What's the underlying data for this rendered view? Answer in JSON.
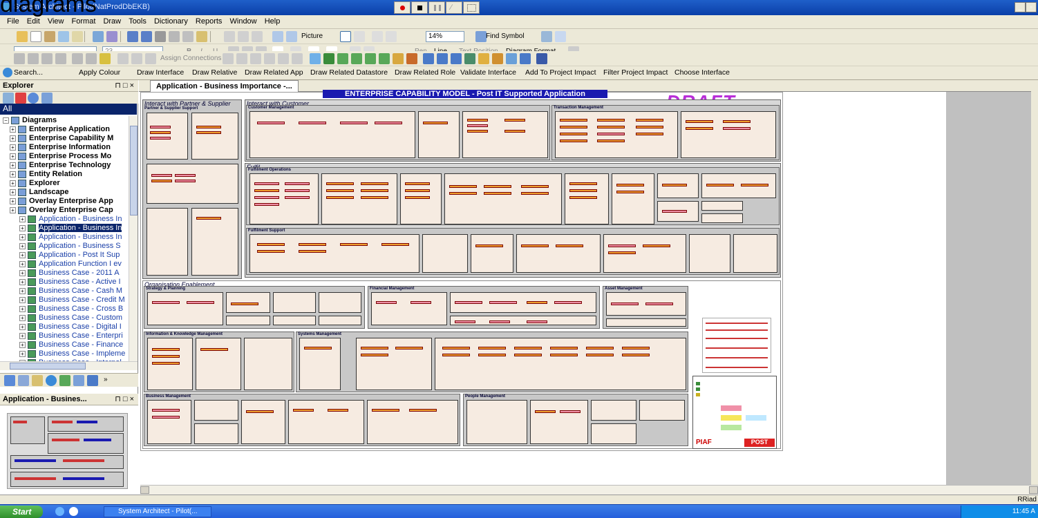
{
  "overlay_caption": "diagrams",
  "window": {
    "title": "System Architect - Pilot(NatProdDbEKB)"
  },
  "menu": [
    "File",
    "Edit",
    "View",
    "Format",
    "Draw",
    "Tools",
    "Dictionary",
    "Reports",
    "Window",
    "Help"
  ],
  "toolbar1": {
    "picture_label": "Picture",
    "zoom": "14%",
    "find_symbol": "Find Symbol"
  },
  "toolbar2": {
    "font_size": "23",
    "labels": [
      "Pen",
      "Line",
      "Text Position",
      "Diagram Format"
    ]
  },
  "toolbar3": {
    "assign_connections": "Assign Connections"
  },
  "commands": [
    "Search...",
    "Apply Colour",
    "Draw Interface",
    "Draw Relative",
    "Draw Related App",
    "Draw Related Datastore",
    "Draw Related Role",
    "Validate Interface",
    "Add To Project Impact",
    "Filter Project Impact",
    "Choose Interface"
  ],
  "explorer": {
    "title": "Explorer",
    "controls": "⊓ □ ×",
    "filter": "All",
    "tree": [
      {
        "label": "Diagrams",
        "level": 0,
        "bold": true
      },
      {
        "label": "Enterprise Application",
        "level": 1,
        "bold": true
      },
      {
        "label": "Enterprise Capability M",
        "level": 1,
        "bold": true
      },
      {
        "label": "Enterprise Information",
        "level": 1,
        "bold": true
      },
      {
        "label": "Enterprise Process Mo",
        "level": 1,
        "bold": true
      },
      {
        "label": "Enterprise Technology",
        "level": 1,
        "bold": true
      },
      {
        "label": "Entity Relation",
        "level": 1,
        "bold": true
      },
      {
        "label": "Explorer",
        "level": 1,
        "bold": true
      },
      {
        "label": "Landscape",
        "level": 1,
        "bold": true
      },
      {
        "label": "Overlay Enterprise App",
        "level": 1,
        "bold": true
      },
      {
        "label": "Overlay Enterprise Cap",
        "level": 1,
        "bold": true
      },
      {
        "label": "Application - Business In",
        "level": 2,
        "bold": false
      },
      {
        "label": "Application - Business In",
        "level": 2,
        "bold": false,
        "selected": true
      },
      {
        "label": "Application - Business In",
        "level": 2,
        "bold": false
      },
      {
        "label": "Application - Business S",
        "level": 2,
        "bold": false
      },
      {
        "label": "Application - Post It Sup",
        "level": 2,
        "bold": false
      },
      {
        "label": "Application Function I ev",
        "level": 2,
        "bold": false
      },
      {
        "label": "Business Case - 2011 A",
        "level": 2,
        "bold": false
      },
      {
        "label": "Business Case - Active I",
        "level": 2,
        "bold": false
      },
      {
        "label": "Business Case - Cash M",
        "level": 2,
        "bold": false
      },
      {
        "label": "Business Case - Credit M",
        "level": 2,
        "bold": false
      },
      {
        "label": "Business Case - Cross B",
        "level": 2,
        "bold": false
      },
      {
        "label": "Business Case - Custom",
        "level": 2,
        "bold": false
      },
      {
        "label": "Business Case - Digital I",
        "level": 2,
        "bold": false
      },
      {
        "label": "Business Case - Enterpri",
        "level": 2,
        "bold": false
      },
      {
        "label": "Business Case - Finance",
        "level": 2,
        "bold": false
      },
      {
        "label": "Business Case - Impleme",
        "level": 2,
        "bold": false
      },
      {
        "label": "Business Case - Internal",
        "level": 2,
        "bold": false
      }
    ]
  },
  "mini_panel": {
    "title": "Application - Busines...",
    "controls": "⊓ □ ×"
  },
  "document_tab": "Application - Business Importance -...",
  "diagram": {
    "title": "ENTERPRISE CAPABILITY MODEL - Post IT Supported Application",
    "stamp": "DRAFT",
    "groups": {
      "partner": "Interact with Partner & Supplier",
      "partner_sub": "Partner & Supplier Support",
      "customer": "Interact with Customer",
      "customer_mgmt": "Customer Management",
      "transaction": "Transaction Management",
      "fulfil": "Fulfil",
      "fulfil_ops": "Fulfilment Operations",
      "fulfil_support": "Fulfilment Support",
      "org": "Organisation Enablement",
      "strategy": "Strategy & Planning",
      "financial": "Financial Management",
      "asset": "Asset Management",
      "info_knowledge": "Information & Knowledge Management",
      "systems": "Systems Management",
      "business": "Business Management",
      "people": "People Management"
    }
  },
  "status": {
    "user": "RRiad"
  },
  "taskbar": {
    "start": "Start",
    "app": "System Architect - Pilot(...",
    "clock": "11:45 A"
  }
}
